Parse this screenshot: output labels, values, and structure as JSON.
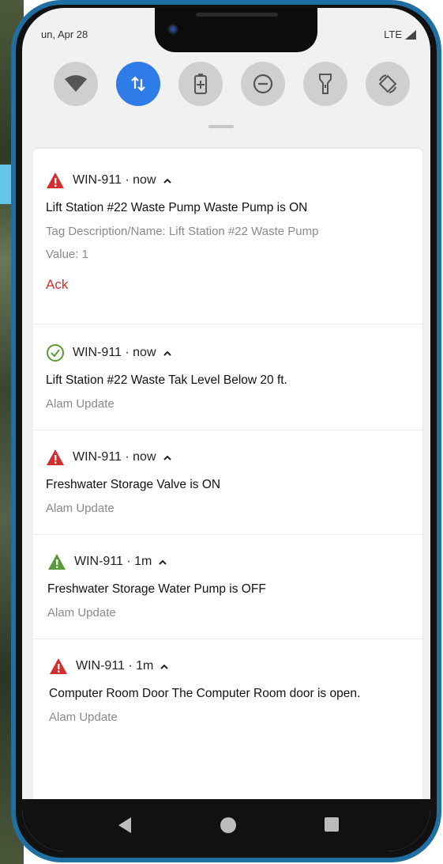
{
  "status_bar": {
    "date": "un, Apr 28",
    "network": "LTE"
  },
  "quick_settings": {
    "tiles": [
      {
        "icon": "wifi-icon",
        "active": false
      },
      {
        "icon": "data-transfer-icon",
        "active": true
      },
      {
        "icon": "battery-saver-icon",
        "active": false
      },
      {
        "icon": "do-not-disturb-icon",
        "active": false
      },
      {
        "icon": "flashlight-icon",
        "active": false
      },
      {
        "icon": "auto-rotate-icon",
        "active": false
      }
    ]
  },
  "colors": {
    "accent": "#2f7be8",
    "alarm_red": "#d32f2f",
    "alarm_green": "#5b9a3a",
    "ok_green": "#5b9a3a",
    "frame_blue": "#1f6fa3"
  },
  "notifications": [
    {
      "icon": "warning-triangle-red-icon",
      "app": "WIN-911 · now",
      "title": "Lift Station #22 Waste Pump Waste Pump is ON",
      "lines": [
        "Tag Description/Name: Lift Station #22 Waste Pump",
        "Value: 1"
      ],
      "action": "Ack"
    },
    {
      "icon": "check-circle-icon",
      "app": "WIN-911 · now",
      "title": "Lift Station #22 Waste Tak Level Below 20 ft.",
      "subtitle": "Alam Update"
    },
    {
      "icon": "warning-triangle-red-icon",
      "app": "WIN-911 · now",
      "title": "Freshwater Storage Valve is ON",
      "subtitle": "Alam Update"
    },
    {
      "icon": "warning-triangle-green-icon",
      "app": "WIN-911 · 1m",
      "title": "Freshwater Storage Water Pump is OFF",
      "subtitle": "Alam Update"
    },
    {
      "icon": "warning-triangle-red-icon",
      "app": "WIN-911 · 1m",
      "title": "Computer Room Door The Computer Room door is open.",
      "subtitle": "Alam Update"
    }
  ],
  "nav_bar": {
    "buttons": [
      "back-icon",
      "home-icon",
      "recents-icon"
    ]
  }
}
